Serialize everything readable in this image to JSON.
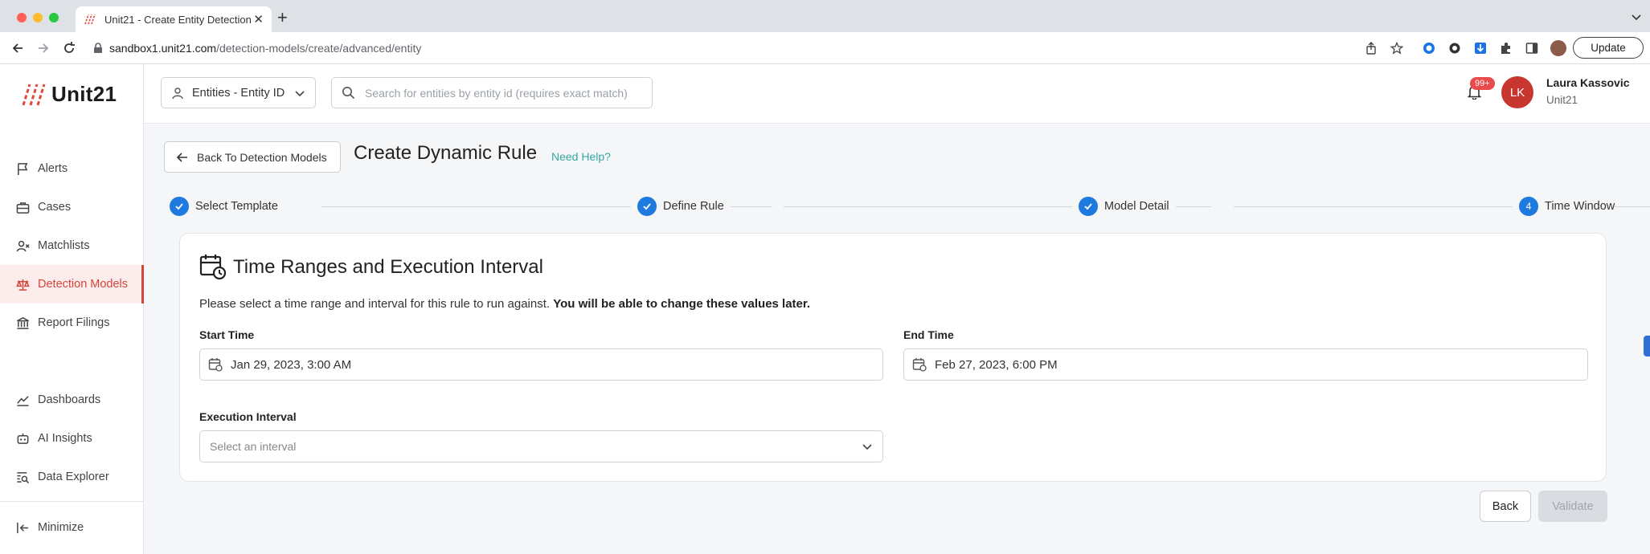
{
  "browser": {
    "tab_title": "Unit21 - Create Entity Detection",
    "url_host": "sandbox1.unit21.com",
    "url_path": "/detection-models/create/advanced/entity",
    "update_label": "Update"
  },
  "sidebar": {
    "logo_text": "Unit21",
    "items": [
      {
        "label": "Alerts",
        "icon": "flag-icon"
      },
      {
        "label": "Cases",
        "icon": "briefcase-icon"
      },
      {
        "label": "Matchlists",
        "icon": "user-x-icon"
      },
      {
        "label": "Detection Models",
        "icon": "scale-icon",
        "active": true
      },
      {
        "label": "Report Filings",
        "icon": "bank-icon"
      },
      {
        "label": "Dashboards",
        "icon": "chart-line-icon"
      },
      {
        "label": "AI Insights",
        "icon": "robot-icon"
      },
      {
        "label": "Data Explorer",
        "icon": "search-list-icon"
      },
      {
        "label": "Minimize",
        "icon": "collapse-icon"
      }
    ]
  },
  "header": {
    "entity_selector": "Entities - Entity ID",
    "search_placeholder": "Search for entities by entity id (requires exact match)",
    "notif_badge": "99+",
    "user_initials": "LK",
    "user_name": "Laura Kassovic",
    "user_org": "Unit21"
  },
  "page": {
    "back_label": "Back To Detection Models",
    "title": "Create Dynamic Rule",
    "help_link": "Need Help?"
  },
  "stepper": {
    "steps": [
      {
        "label": "Select Template",
        "status": "complete"
      },
      {
        "label": "Define Rule",
        "status": "complete"
      },
      {
        "label": "Model Detail",
        "status": "complete"
      },
      {
        "label": "Time Window",
        "status": "current",
        "number": "4"
      }
    ]
  },
  "card": {
    "title": "Time Ranges and Execution Interval",
    "description": "Please select a time range and interval for this rule to run against.",
    "description_bold": "You will be able to change these values later.",
    "start_label": "Start Time",
    "start_value": "Jan 29, 2023, 3:00 AM",
    "end_label": "End Time",
    "end_value": "Feb 27, 2023, 6:00 PM",
    "interval_label": "Execution Interval",
    "interval_placeholder": "Select an interval"
  },
  "actions": {
    "back_label": "Back",
    "validate_label": "Validate"
  },
  "colors": {
    "accent_red": "#d3453a",
    "step_blue": "#1f7ae0",
    "link_teal": "#3aa7a3"
  }
}
